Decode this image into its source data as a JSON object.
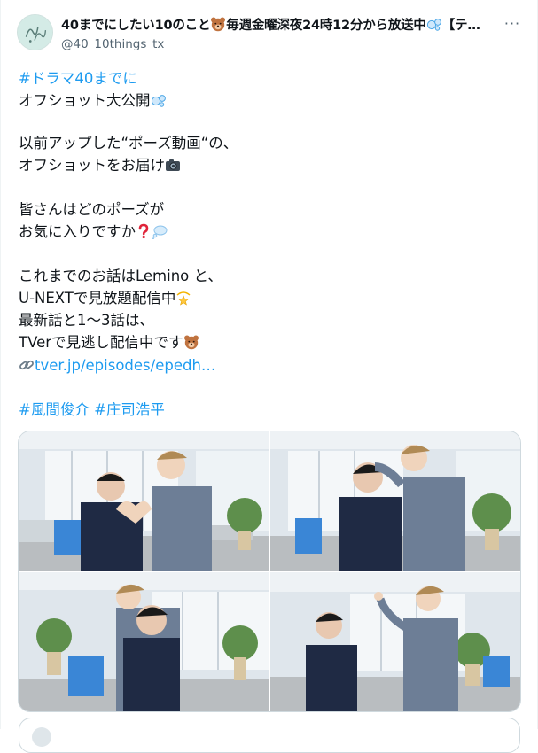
{
  "account": {
    "display_name": "40までにしたい10のこと",
    "name_suffix": "毎週金曜深夜24時12分から放送中",
    "name_tail": "【テ…",
    "handle": "@40_10things_tx",
    "more_label": "···"
  },
  "tweet": {
    "hashtag_drama": "#ドラマ40までに",
    "line_offshot": "オフショット大公開",
    "line_pose_video": "以前アップした“ポーズ動画“の、",
    "line_deliver": "オフショットをお届け",
    "line_question1": "皆さんはどのポーズが",
    "line_question2": "お気に入りですか",
    "line_stream1": "これまでのお話はLemino と、",
    "line_stream2": "U-NEXTで見放題配信中",
    "line_stream3": "最新話と1～3話は、",
    "line_stream4": "TVerで見逃し配信中です",
    "link_text": "tver.jp/episodes/epedh…",
    "hashtags": "#風間俊介 #庄司浩平"
  },
  "icons": {
    "bubbles": "bubbles-icon",
    "camera": "camera-icon",
    "question": "red-question-icon",
    "thought": "thought-bubble-icon",
    "dizzy": "dizzy-star-icon",
    "bear": "bear-face-icon",
    "link": "link-icon",
    "more": "more-dots-icon"
  },
  "colors": {
    "link": "#1d9bf0",
    "text": "#0f1419",
    "secondary": "#536471",
    "border": "#cfd9de"
  },
  "photos": [
    {
      "pose": "heart-hands"
    },
    {
      "pose": "head-pat"
    },
    {
      "pose": "back-hug"
    },
    {
      "pose": "pointing"
    }
  ]
}
